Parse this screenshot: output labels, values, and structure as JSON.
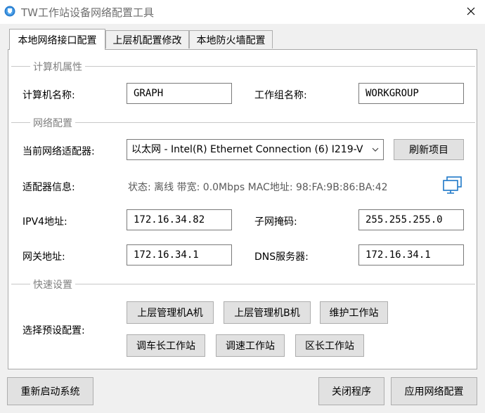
{
  "window": {
    "title": "TW工作站设备网络配置工具"
  },
  "tabs": [
    "本地网络接口配置",
    "上层机配置修改",
    "本地防火墙配置"
  ],
  "computer_group": {
    "label": "计算机属性",
    "name_label": "计算机名称:",
    "name_value": "GRAPH",
    "workgroup_label": "工作组名称:",
    "workgroup_value": "WORKGROUP"
  },
  "network_group": {
    "label": "网络配置",
    "adapter_label": "当前网络适配器:",
    "adapter_value": "以太网 - Intel(R) Ethernet Connection (6) I219-V",
    "refresh_label": "刷新项目",
    "info_label": "适配器信息:",
    "info_value": "状态: 离线  带宽: 0.0Mbps  MAC地址: 98:FA:9B:86:BA:42",
    "ipv4_label": "IPV4地址:",
    "ipv4_value": "172.16.34.82",
    "mask_label": "子网掩码:",
    "mask_value": "255.255.255.0",
    "gateway_label": "网关地址:",
    "gateway_value": "172.16.34.1",
    "dns_label": "DNS服务器:",
    "dns_value": "172.16.34.1"
  },
  "quick_group": {
    "label": "快速设置",
    "preset_label": "选择预设配置:",
    "presets": [
      "上层管理机A机",
      "上层管理机B机",
      "维护工作站",
      "调车长工作站",
      "调速工作站",
      "区长工作站"
    ]
  },
  "footer": {
    "restart_label": "重新启动系统",
    "close_label": "关闭程序",
    "apply_label": "应用网络配置"
  },
  "colors": {
    "accent": "#1e78c8",
    "group_label": "#808080",
    "info_text": "#5a5a5a"
  }
}
